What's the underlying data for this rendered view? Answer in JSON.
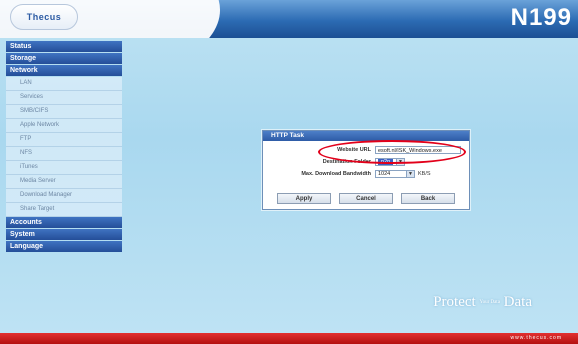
{
  "header": {
    "logo": "Thecus",
    "model": "N199"
  },
  "sidebar": {
    "sections": [
      {
        "label": "Status"
      },
      {
        "label": "Storage"
      },
      {
        "label": "Network"
      },
      {
        "label": "Accounts"
      },
      {
        "label": "System"
      },
      {
        "label": "Language"
      }
    ],
    "network_items": [
      "LAN",
      "Services",
      "SMB/CIFS",
      "Apple Network",
      "FTP",
      "NFS",
      "iTunes",
      "Media Server",
      "Download Manager",
      "Share Target"
    ]
  },
  "dialog": {
    "title": "HTTP Task",
    "website_url_label": "Website URL",
    "website_url_value": "esoft.nl/ISK_Windows.exe",
    "destination_folder_label": "Destination Folder",
    "destination_folder_value": "p2p",
    "bandwidth_label": "Max. Download Bandwidth",
    "bandwidth_value": "1024",
    "bandwidth_unit": "KB/S",
    "buttons": {
      "apply": "Apply",
      "cancel": "Cancel",
      "back": "Back"
    }
  },
  "footer": {
    "tagline": "Protect",
    "tagline_small": "Your Data",
    "tagline_end": "Data",
    "url": "www.thecus.com"
  },
  "colors": {
    "highlight": "#e2001a",
    "accent": "#2c6bb3",
    "footer_bar": "#c41a1a"
  }
}
